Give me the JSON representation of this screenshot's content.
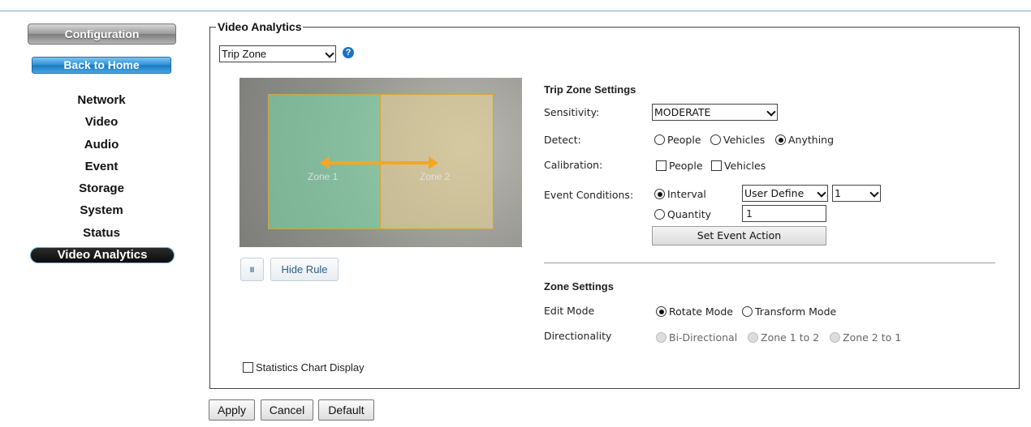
{
  "sidebar": {
    "config_label": "Configuration",
    "home_label": "Back to Home",
    "items": [
      {
        "label": "Network"
      },
      {
        "label": "Video"
      },
      {
        "label": "Audio"
      },
      {
        "label": "Event"
      },
      {
        "label": "Storage"
      },
      {
        "label": "System"
      },
      {
        "label": "Status"
      }
    ],
    "active_label": "Video Analytics"
  },
  "panel": {
    "legend": "Video Analytics",
    "mode_select": "Trip Zone",
    "help_icon": "question-circle-icon"
  },
  "preview": {
    "zone1_label": "Zone 1",
    "zone2_label": "Zone 2",
    "pause_icon": "pause-icon",
    "hide_rule_label": "Hide Rule",
    "stats_label": "Statistics Chart Display"
  },
  "trip_zone": {
    "heading": "Trip Zone Settings",
    "sensitivity_label": "Sensitivity:",
    "sensitivity_value": "MODERATE",
    "detect_label": "Detect:",
    "detect_options": [
      "People",
      "Vehicles",
      "Anything"
    ],
    "detect_selected": "Anything",
    "calibration_label": "Calibration:",
    "calibration_options": [
      "People",
      "Vehicles"
    ],
    "event_conditions_label": "Event Conditions:",
    "interval_label": "Interval",
    "interval_mode": "User Define",
    "interval_value": "1",
    "quantity_label": "Quantity",
    "quantity_value": "1",
    "set_event_action_label": "Set Event Action"
  },
  "zone_settings": {
    "heading": "Zone Settings",
    "edit_mode_label": "Edit Mode",
    "rotate_label": "Rotate Mode",
    "transform_label": "Transform Mode",
    "directionality_label": "Directionality",
    "dir_options": [
      "Bi-Directional",
      "Zone 1 to 2",
      "Zone 2 to 1"
    ]
  },
  "footer": {
    "apply": "Apply",
    "cancel": "Cancel",
    "default": "Default"
  },
  "colors": {
    "accent": "#1a78bf",
    "zone1": "#78dcaa",
    "zone2": "#ebd796",
    "arrow": "#f5a623"
  }
}
